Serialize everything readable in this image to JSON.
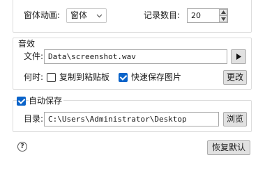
{
  "top": {
    "anim_label": "窗体动画:",
    "anim_value": "窗体",
    "records_label": "记录数目:",
    "records_value": "20"
  },
  "sound": {
    "title": "音效",
    "file_label": "文件:",
    "file_value": "Data\\screenshot.wav",
    "when_label": "何时:",
    "copy_clipboard_label": "复制到粘贴板",
    "copy_clipboard_checked": false,
    "quick_save_label": "快速保存图片",
    "quick_save_checked": true,
    "change_label": "更改"
  },
  "autosave": {
    "title": "自动保存",
    "checked": true,
    "dir_label": "目录:",
    "dir_value": "C:\\Users\\Administrator\\Desktop",
    "browse_label": "浏览"
  },
  "footer": {
    "help_glyph": "?",
    "restore_label": "恢复默认"
  },
  "colors": {
    "accent": "#0a63c9",
    "border": "#dcdcdc",
    "button": "#e1e1e1"
  }
}
